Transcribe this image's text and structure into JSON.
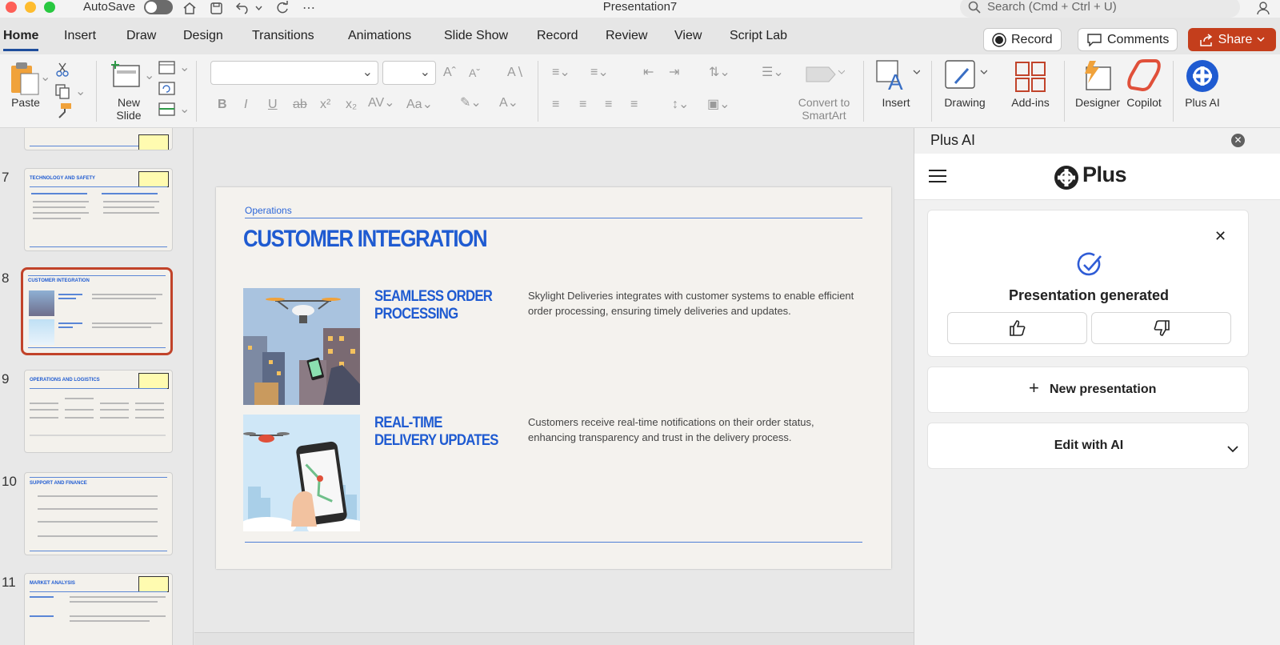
{
  "window": {
    "title": "Presentation7",
    "autosave_label": "AutoSave",
    "autosave_on": false
  },
  "search": {
    "placeholder": "Search (Cmd + Ctrl + U)"
  },
  "tabs": [
    "Home",
    "Insert",
    "Draw",
    "Design",
    "Transitions",
    "Animations",
    "Slide Show",
    "Record",
    "Review",
    "View",
    "Script Lab"
  ],
  "active_tab": "Home",
  "header_buttons": {
    "record": "Record",
    "comments": "Comments",
    "share": "Share"
  },
  "ribbon": {
    "paste": "Paste",
    "new_slide": "New Slide",
    "convert_smartart": "Convert to SmartArt",
    "insert": "Insert",
    "drawing": "Drawing",
    "addins": "Add-ins",
    "designer": "Designer",
    "copilot": "Copilot",
    "plus_ai": "Plus AI"
  },
  "thumbnails": [
    {
      "num": "",
      "title": ""
    },
    {
      "num": "7",
      "title": "TECHNOLOGY AND SAFETY"
    },
    {
      "num": "8",
      "title": "CUSTOMER INTEGRATION"
    },
    {
      "num": "9",
      "title": "OPERATIONS AND LOGISTICS"
    },
    {
      "num": "10",
      "title": "SUPPORT AND FINANCE"
    },
    {
      "num": "11",
      "title": "MARKET ANALYSIS"
    }
  ],
  "selected_slide": "8",
  "slide": {
    "eyebrow": "Operations",
    "title": "CUSTOMER INTEGRATION",
    "items": [
      {
        "heading": "SEAMLESS ORDER PROCESSING",
        "body": "Skylight Deliveries integrates with customer systems to enable efficient order processing, ensuring timely deliveries and updates."
      },
      {
        "heading": "REAL-TIME DELIVERY UPDATES",
        "body": "Customers receive real-time notifications on their order status, enhancing transparency and trust in the delivery process."
      }
    ]
  },
  "plus_panel": {
    "title": "Plus AI",
    "brand": "Plus",
    "status": "Presentation generated",
    "new_presentation": "New presentation",
    "edit_with_ai": "Edit with AI"
  },
  "colors": {
    "accent": "#1f5bd1",
    "share": "#c43e1c",
    "selected_thumb": "#c1432a"
  }
}
